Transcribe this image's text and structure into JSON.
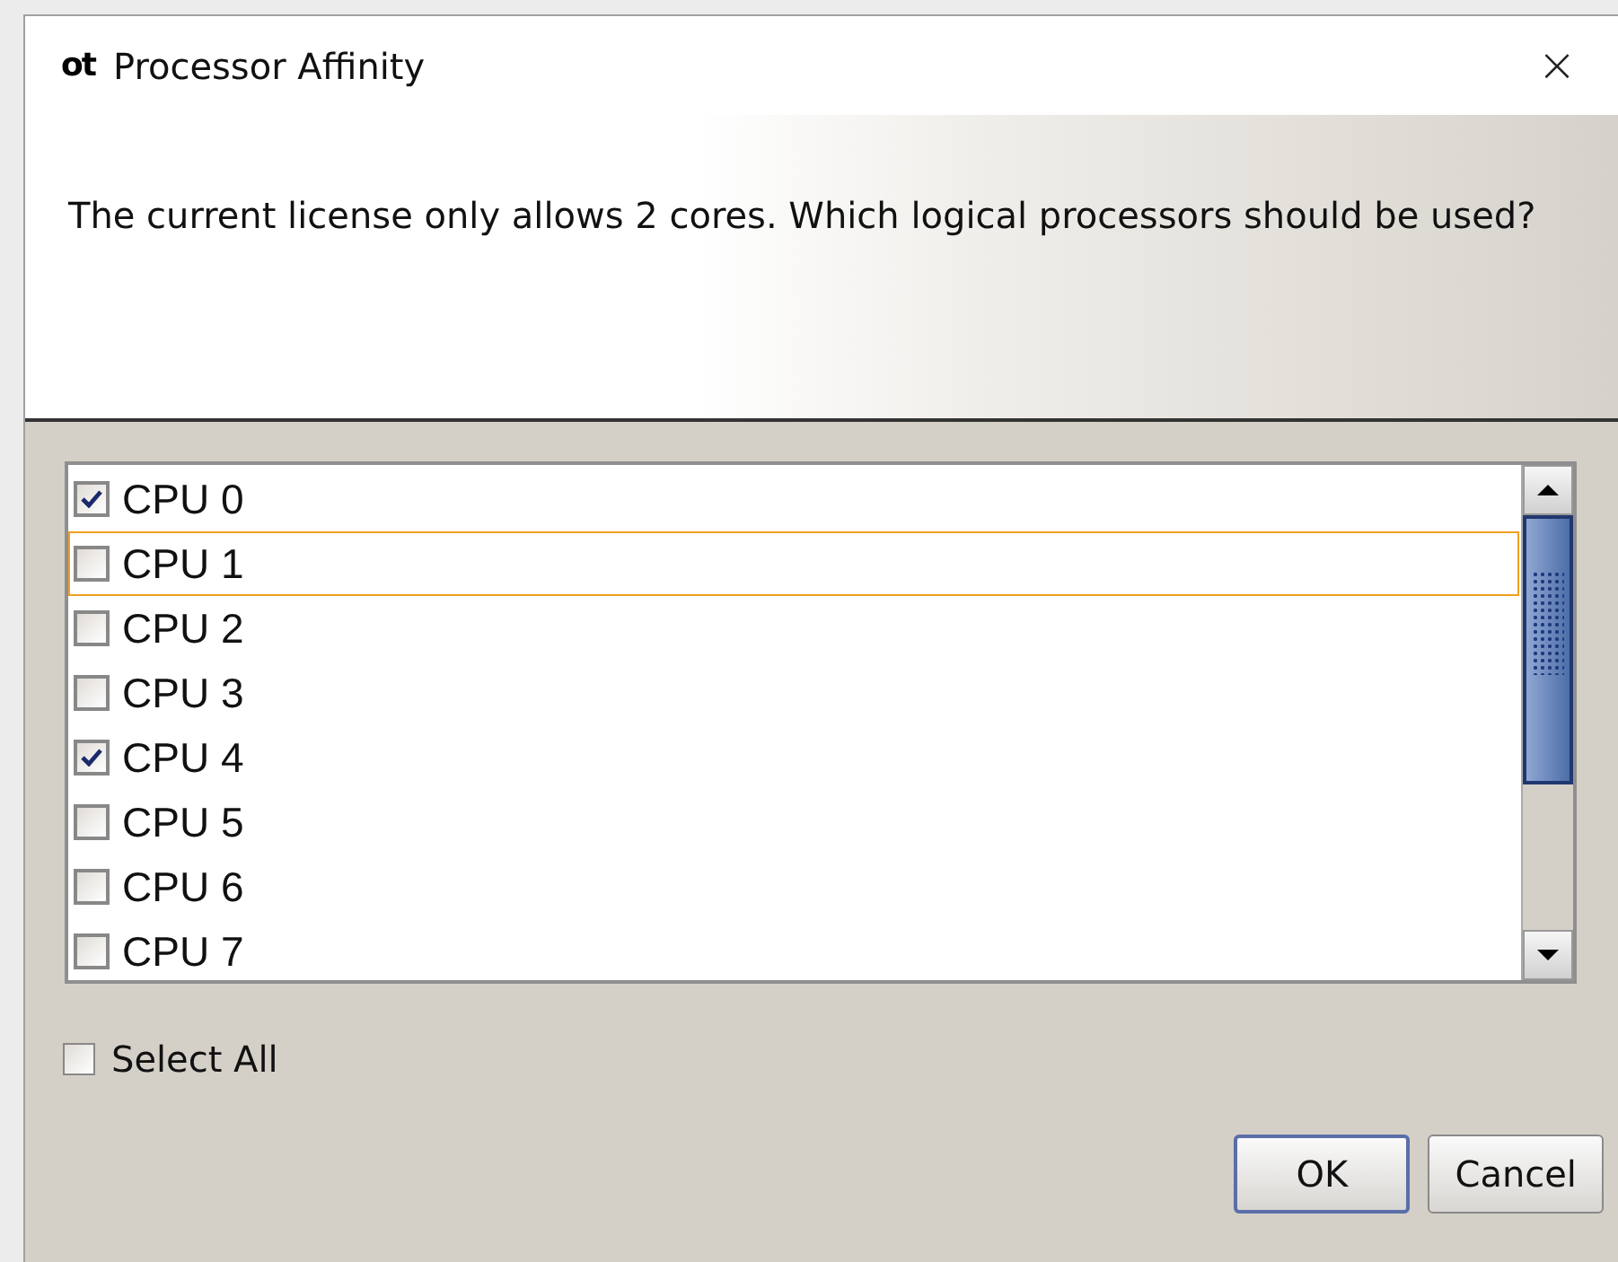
{
  "window": {
    "logo": "ot",
    "title": "Processor Affinity",
    "close": "×"
  },
  "message": "The current license only allows 2 cores. Which logical processors should be used?",
  "processors": [
    {
      "label": "CPU 0",
      "checked": true,
      "focused": false
    },
    {
      "label": "CPU 1",
      "checked": false,
      "focused": true
    },
    {
      "label": "CPU 2",
      "checked": false,
      "focused": false
    },
    {
      "label": "CPU 3",
      "checked": false,
      "focused": false
    },
    {
      "label": "CPU 4",
      "checked": true,
      "focused": false
    },
    {
      "label": "CPU 5",
      "checked": false,
      "focused": false
    },
    {
      "label": "CPU 6",
      "checked": false,
      "focused": false
    },
    {
      "label": "CPU 7",
      "checked": false,
      "focused": false
    }
  ],
  "select_all": {
    "label": "Select All",
    "checked": false
  },
  "buttons": [
    {
      "label": "OK",
      "default": true
    },
    {
      "label": "Cancel",
      "default": false
    }
  ]
}
